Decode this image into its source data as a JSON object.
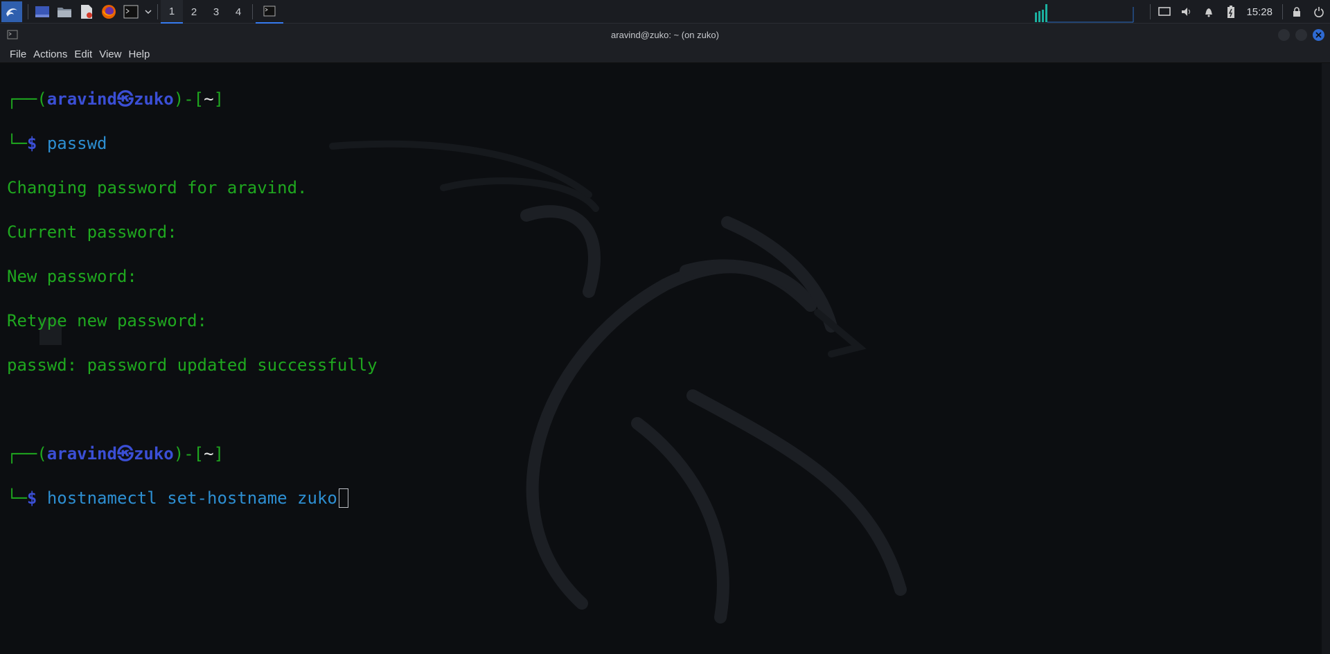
{
  "panel": {
    "workspaces": [
      "1",
      "2",
      "3",
      "4"
    ],
    "active_workspace": "1",
    "clock": "15:28",
    "launchers": [
      "kali-menu-icon",
      "desktop-icon",
      "files-icon",
      "text-editor-icon",
      "firefox-icon",
      "terminal-icon",
      "chevron-down-icon"
    ],
    "tray": [
      "display-icon",
      "volume-icon",
      "notification-icon",
      "battery-icon",
      "lock-icon",
      "power-icon"
    ]
  },
  "window": {
    "title": "aravind@zuko: ~ (on zuko)",
    "menu": [
      "File",
      "Actions",
      "Edit",
      "View",
      "Help"
    ]
  },
  "terminal": {
    "prompt1": {
      "open": "┌──(",
      "user": "aravind",
      "at": "㉿",
      "host": "zuko",
      "mid": ")-[",
      "dir": "~",
      "close": "]"
    },
    "prompt1_line2": {
      "corner": "└─",
      "dollar": "$ ",
      "command": "passwd"
    },
    "output": [
      "Changing password for aravind.",
      "Current password:",
      "New password:",
      "Retype new password:",
      "passwd: password updated successfully"
    ],
    "prompt2": {
      "open": "┌──(",
      "user": "aravind",
      "at": "㉿",
      "host": "zuko",
      "mid": ")-[",
      "dir": "~",
      "close": "]"
    },
    "prompt2_line2": {
      "corner": "└─",
      "dollar": "$ ",
      "command": "hostnamectl set-hostname zuko"
    }
  },
  "colors": {
    "prompt_green": "#1fa81f",
    "user_blue": "#3b4fd6",
    "command_blue": "#2d8fd2",
    "accent": "#367bf0"
  }
}
